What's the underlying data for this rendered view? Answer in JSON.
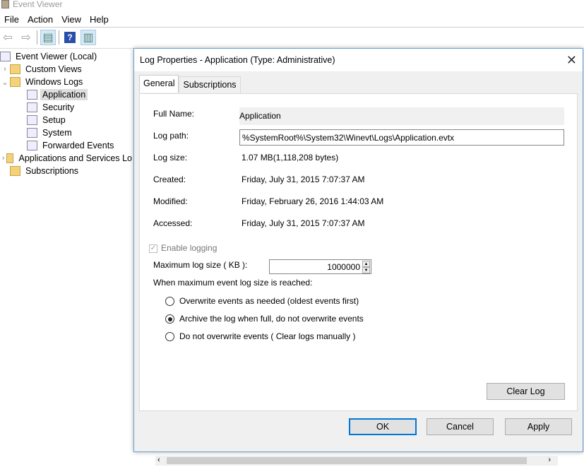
{
  "window": {
    "title": "Event Viewer"
  },
  "menu": [
    "File",
    "Action",
    "View",
    "Help"
  ],
  "toolbar": {
    "icons": [
      "back-arrow-icon",
      "forward-arrow-icon",
      "show-hide-console-tree-icon",
      "help-icon",
      "show-hide-action-pane-icon"
    ]
  },
  "tree": {
    "root": "Event Viewer (Local)",
    "items": [
      {
        "label": "Custom Views",
        "expander": "›"
      },
      {
        "label": "Windows Logs",
        "expander": "⌄"
      },
      {
        "label": "Application"
      },
      {
        "label": "Security"
      },
      {
        "label": "Setup"
      },
      {
        "label": "System"
      },
      {
        "label": "Forwarded Events"
      },
      {
        "label": "Applications and Services Lo",
        "expander": "›"
      },
      {
        "label": "Subscriptions"
      }
    ]
  },
  "dialog": {
    "title": "Log Properties - Application (Type: Administrative)",
    "close": "✕",
    "tabs": [
      "General",
      "Subscriptions"
    ],
    "labels": {
      "full_name": "Full Name:",
      "log_path": "Log path:",
      "log_size": "Log size:",
      "created": "Created:",
      "modified": "Modified:",
      "accessed": "Accessed:"
    },
    "values": {
      "full_name": "Application",
      "log_path": "%SystemRoot%\\System32\\Winevt\\Logs\\Application.evtx",
      "log_size": "1.07 MB(1,118,208 bytes)",
      "created": "Friday, July 31, 2015 7:07:37 AM",
      "modified": "Friday, February 26, 2016 1:44:03 AM",
      "accessed": "Friday, July 31, 2015 7:07:37 AM"
    },
    "enable_logging": {
      "label": "Enable logging",
      "checked": true,
      "disabled": true
    },
    "max_size": {
      "label": "Maximum log size ( KB ):",
      "value": "1000000"
    },
    "when_full": "When maximum event log size is reached:",
    "options": [
      {
        "label": "Overwrite events as needed (oldest events first)",
        "selected": false
      },
      {
        "label": "Archive the log when full, do not overwrite events",
        "selected": true
      },
      {
        "label": "Do not overwrite events ( Clear logs manually )",
        "selected": false
      }
    ],
    "clear_log": "Clear Log",
    "ok": "OK",
    "cancel": "Cancel",
    "apply": "Apply"
  }
}
